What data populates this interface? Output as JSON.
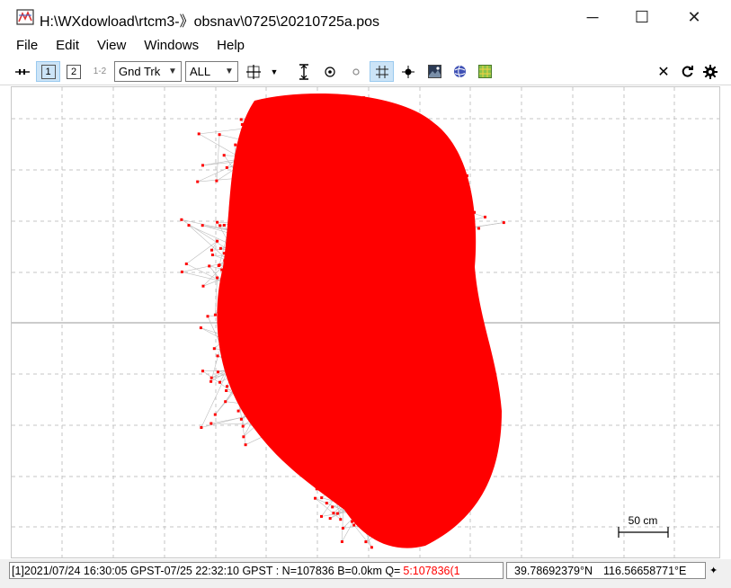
{
  "window": {
    "title": "H:\\WXdowload\\rtcm3-》obsnav\\0725\\20210725a.pos",
    "minimize_glyph": "─",
    "maximize_glyph": "☐",
    "close_glyph": "✕"
  },
  "menu": [
    "File",
    "Edit",
    "View",
    "Windows",
    "Help"
  ],
  "toolbar": {
    "btn1_label": "1",
    "btn2_label": "2",
    "btn12_label": "1-2",
    "plot_type": "Gnd Trk",
    "sat_filter": "ALL",
    "icons": [
      "track-icon",
      "crosshair-icon",
      "dropdown-arrow-icon",
      "fit-vertical-icon",
      "center-icon",
      "origin-icon",
      "grid-icon",
      "point-icon",
      "image-icon",
      "globe-icon",
      "map-icon",
      "close-icon",
      "reload-icon",
      "settings-icon"
    ]
  },
  "plot": {
    "scale_label": "50 cm",
    "point_color": "#ff0000",
    "line_color": "#bdbdbd"
  },
  "status": {
    "info": "[1]2021/07/24 16:30:05 GPST-07/25 22:32:10 GPST : N=107836 B=0.0km Q=",
    "quality": "5:107836(1",
    "quality_color": "#ff0000",
    "lat": "39.78692379°N",
    "lon": "116.56658771°E",
    "resize_glyph": "✦"
  }
}
